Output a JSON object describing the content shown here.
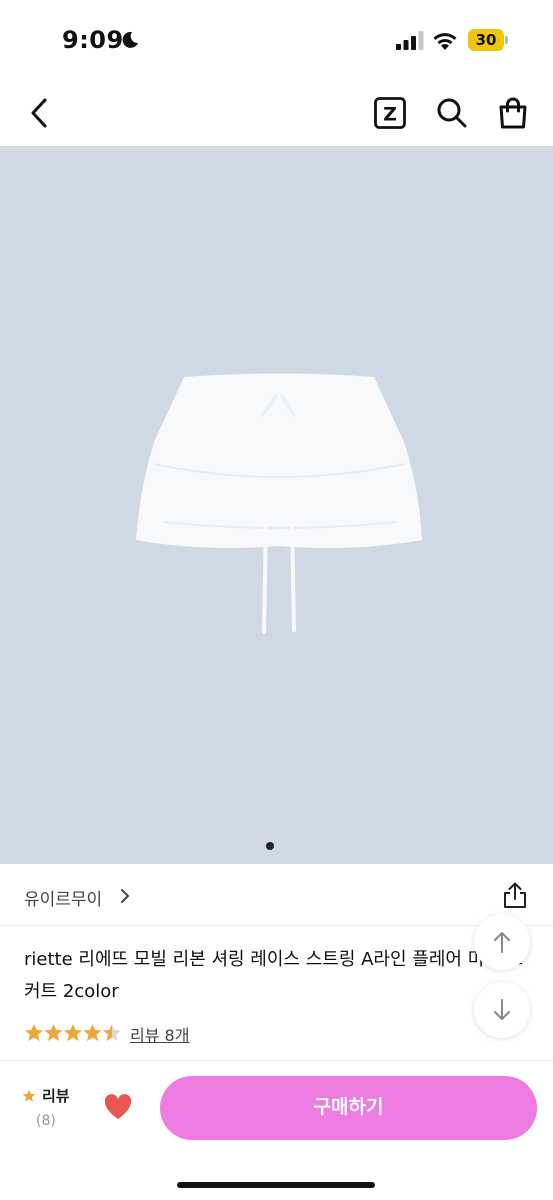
{
  "status_bar": {
    "time": "9:09",
    "battery": "30",
    "icons": [
      "moon-icon",
      "signal-icon",
      "wifi-icon",
      "battery-icon"
    ],
    "battery_color": "#f1c40f"
  },
  "nav": {
    "z_label": "Z",
    "icons": [
      "back-icon",
      "z-icon",
      "search-icon",
      "shopping-bag-icon"
    ]
  },
  "product": {
    "image_background": "#cfd9e3",
    "image_count": 1,
    "active_image": 1
  },
  "brand": {
    "name": "유이르무이",
    "icons": [
      "chevron-right-icon",
      "share-icon"
    ]
  },
  "title": "riette 리에뜨 모빌 리본 셔링 레이스 스트링 A라인 플레어 미니 스커트 2color",
  "rating": {
    "value": 4.5,
    "max": 5,
    "review_link": "리뷰 8개",
    "star_color": "#f0a53b"
  },
  "bottom_bar": {
    "review_label": "리뷰",
    "review_count": "(8)",
    "buy_label": "구매하기",
    "buy_color": "#ee7bdf",
    "heart_color": "#e8574f"
  }
}
